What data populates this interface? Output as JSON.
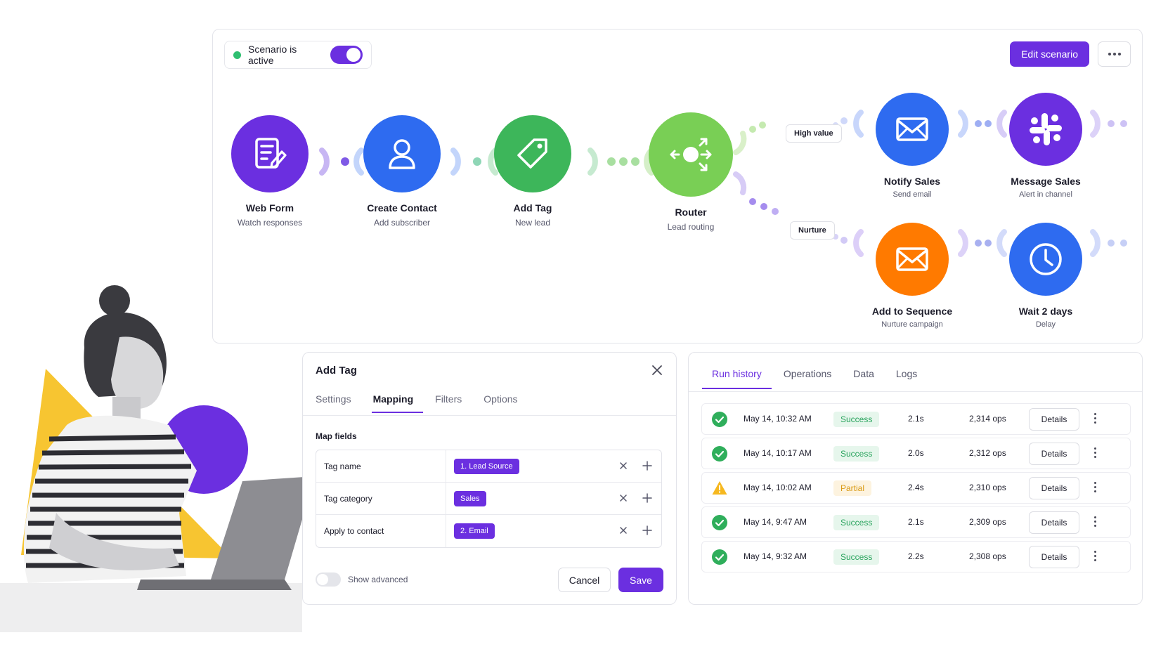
{
  "scenario": {
    "status_text": "Scenario is active",
    "edit_label": "Edit scenario",
    "colors": {
      "accent": "#6b2fe0",
      "active": "#2fbf71"
    }
  },
  "flow": {
    "nodes": [
      {
        "id": "web-form",
        "title": "Web Form",
        "subtitle": "Watch responses",
        "color": "#6b2fe0",
        "icon": "form-icon"
      },
      {
        "id": "create-contact",
        "title": "Create Contact",
        "subtitle": "Add subscriber",
        "color": "#2e6bf0",
        "icon": "user-icon"
      },
      {
        "id": "add-tag",
        "title": "Add Tag",
        "subtitle": "New lead",
        "color": "#3db65a",
        "icon": "tag-icon"
      },
      {
        "id": "router",
        "title": "Router",
        "subtitle": "Lead routing",
        "color": "#79cf55",
        "icon": "router-icon"
      },
      {
        "id": "notify-sales",
        "title": "Notify Sales",
        "subtitle": "Send email",
        "color": "#2e6bf0",
        "icon": "mail-icon"
      },
      {
        "id": "message-sales",
        "title": "Message Sales",
        "subtitle": "Alert in channel",
        "color": "#6b2fe0",
        "icon": "slack-icon"
      },
      {
        "id": "add-to-sequence",
        "title": "Add to Sequence",
        "subtitle": "Nurture campaign",
        "color": "#ff7a00",
        "icon": "mail-icon"
      },
      {
        "id": "wait-2-days",
        "title": "Wait 2 days",
        "subtitle": "Delay",
        "color": "#2e6bf0",
        "icon": "clock-icon"
      }
    ],
    "routes": {
      "high_value": "High value",
      "nurture": "Nurture"
    }
  },
  "add_tag_panel": {
    "title": "Add Tag",
    "tabs": [
      "Settings",
      "Mapping",
      "Filters",
      "Options"
    ],
    "active_tab": "Mapping",
    "section_label": "Map fields",
    "rows": [
      {
        "key": "Tag name",
        "value": "1. Lead Source"
      },
      {
        "key": "Tag category",
        "value": "Sales"
      },
      {
        "key": "Apply to contact",
        "value": "2. Email"
      }
    ],
    "show_advanced": "Show advanced",
    "cancel": "Cancel",
    "save": "Save"
  },
  "run_panel": {
    "tabs": [
      "Run history",
      "Operations",
      "Data",
      "Logs"
    ],
    "active_tab": "Run history",
    "details_label": "Details",
    "runs": [
      {
        "status_icon": "check-icon",
        "date": "May 14, 10:32 AM",
        "status": "Success",
        "duration": "2.1s",
        "ops": "2,314 ops"
      },
      {
        "status_icon": "check-icon",
        "date": "May 14, 10:17 AM",
        "status": "Success",
        "duration": "2.0s",
        "ops": "2,312 ops"
      },
      {
        "status_icon": "warning-icon",
        "date": "May 14, 10:02 AM",
        "status": "Partial",
        "duration": "2.4s",
        "ops": "2,310 ops"
      },
      {
        "status_icon": "check-icon",
        "date": "May 14, 9:47 AM",
        "status": "Success",
        "duration": "2.1s",
        "ops": "2,309 ops"
      },
      {
        "status_icon": "check-icon",
        "date": "May 14, 9:32 AM",
        "status": "Success",
        "duration": "2.2s",
        "ops": "2,308 ops"
      }
    ]
  }
}
